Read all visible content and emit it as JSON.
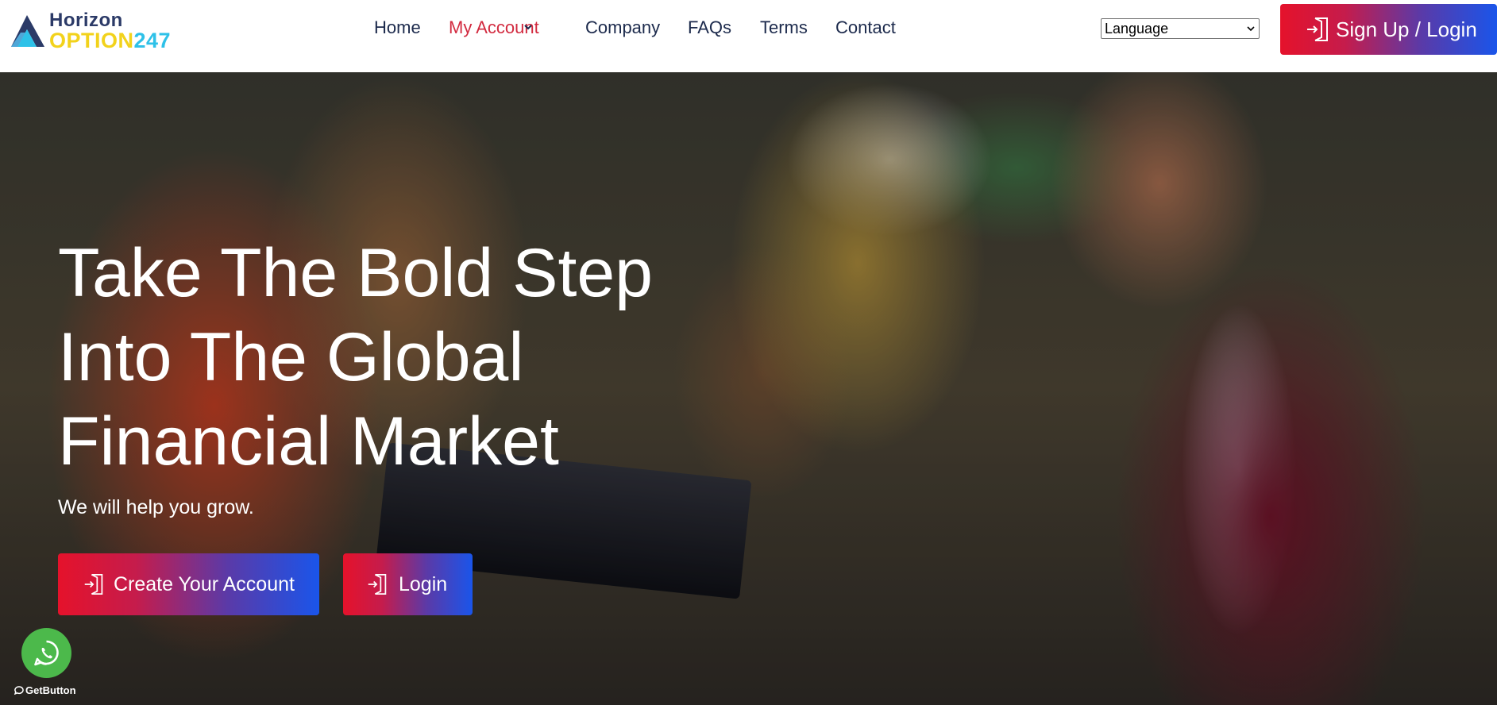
{
  "brand": {
    "line1": "Horizon",
    "line2_word": "OPTION",
    "line2_num": "247",
    "colors": {
      "navy": "#2b3a67",
      "yellow": "#f2d21b",
      "cyan": "#2ec1e8"
    }
  },
  "nav": {
    "items": [
      {
        "label": "Home"
      },
      {
        "label": "My Account"
      },
      {
        "label": "Company"
      },
      {
        "label": "FAQs"
      },
      {
        "label": "Terms"
      },
      {
        "label": "Contact"
      }
    ],
    "active_color": "#d22a3f"
  },
  "language_select": {
    "selected": "Language",
    "options": [
      "Language"
    ]
  },
  "header_cta": {
    "label": "Sign Up / Login",
    "icon": "sign-in-icon"
  },
  "hero": {
    "headline": [
      "Take The Bold Step",
      "Into The Global",
      "Financial Market"
    ],
    "subline": "We will help you grow.",
    "buttons": {
      "create": "Create Your Account",
      "login": "Login"
    }
  },
  "widget": {
    "icon": "whatsapp-icon",
    "credit": "GetButton"
  },
  "accent_gradient": [
    "#e5122b",
    "#1a55ea"
  ]
}
